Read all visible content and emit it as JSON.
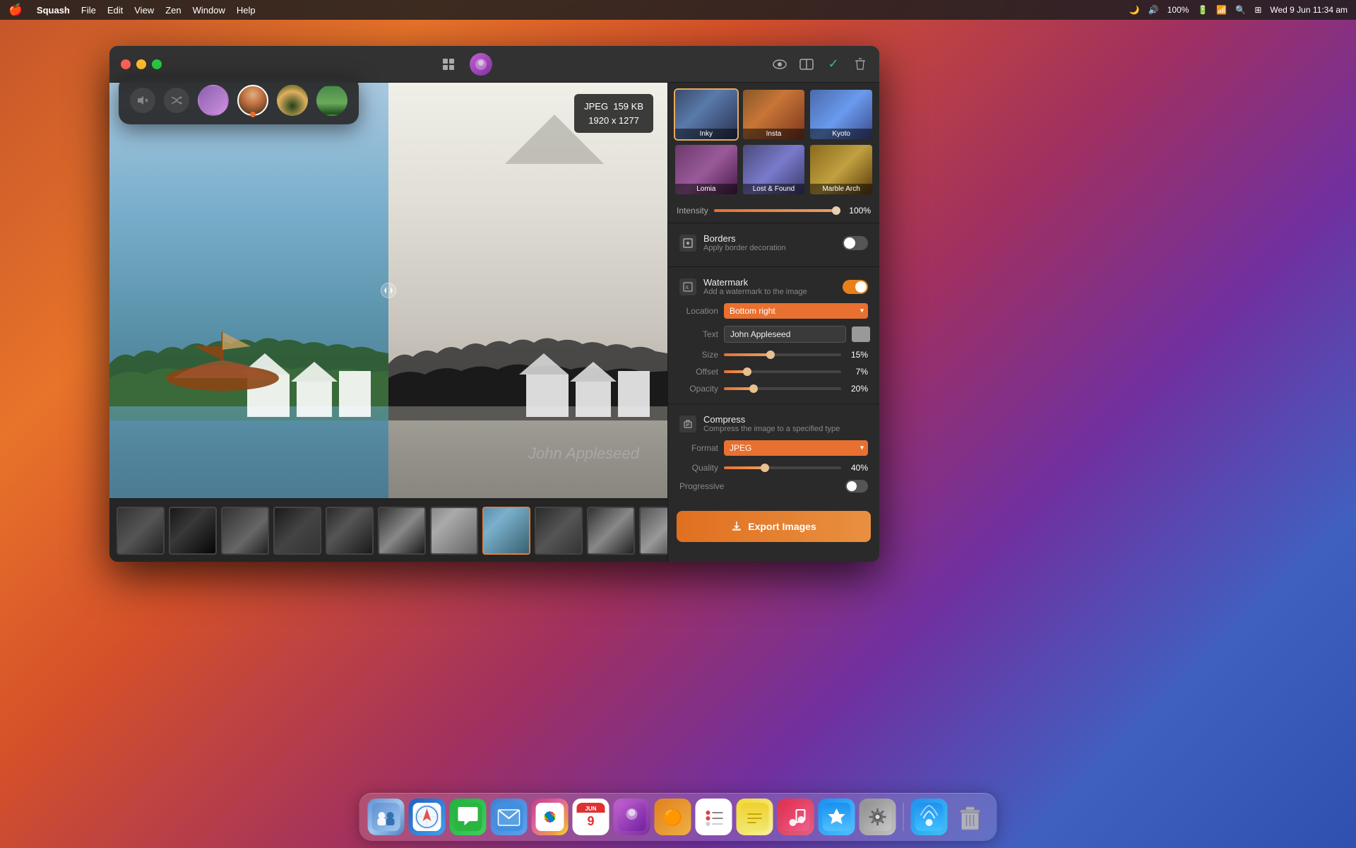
{
  "menubar": {
    "apple": "🍎",
    "app_name": "Squash",
    "menus": [
      "File",
      "Edit",
      "View",
      "Zen",
      "Window",
      "Help"
    ],
    "right_items": [
      "Wed 9 Jun  11:34 am"
    ],
    "battery": "100%"
  },
  "titlebar": {
    "preview_label": "👁",
    "split_label": "⊟",
    "done_label": "✓",
    "delete_label": "🗑"
  },
  "image_info": {
    "format": "JPEG",
    "size": "159 KB",
    "dimensions": "1920 x 1277"
  },
  "watermark_text": "John Appleseed",
  "filters": {
    "items": [
      {
        "id": "inky",
        "label": "Inky",
        "active": true
      },
      {
        "id": "insta",
        "label": "Insta",
        "active": false
      },
      {
        "id": "kyoto",
        "label": "Kyoto",
        "active": false
      },
      {
        "id": "lomia",
        "label": "Lomia",
        "active": false
      },
      {
        "id": "lostandfound",
        "label": "Lost & Found",
        "active": false
      },
      {
        "id": "marble",
        "label": "Marble Arch",
        "active": false
      }
    ],
    "intensity_label": "Intensity",
    "intensity_value": "100%",
    "intensity_percent": 100
  },
  "borders_section": {
    "title": "Borders",
    "subtitle": "Apply border decoration",
    "enabled": false
  },
  "watermark_section": {
    "title": "Watermark",
    "subtitle": "Add a watermark to the image",
    "enabled": true,
    "location_label": "Location",
    "location_value": "Bottom right",
    "text_label": "Text",
    "text_value": "John Appleseed",
    "size_label": "Size",
    "size_value": "15%",
    "size_percent": 40,
    "offset_label": "Offset",
    "offset_value": "7%",
    "offset_percent": 20,
    "opacity_label": "Opacity",
    "opacity_value": "20%",
    "opacity_percent": 25
  },
  "compress_section": {
    "title": "Compress",
    "subtitle": "Compress the image to a specified type",
    "format_label": "Format",
    "format_value": "JPEG",
    "quality_label": "Quality",
    "quality_value": "40%",
    "quality_percent": 35,
    "progressive_label": "Progressive",
    "progressive_enabled": false
  },
  "export": {
    "button_label": "Export Images"
  },
  "float_toolbar": {
    "mute_icon": "🔇",
    "shuffle_icon": "⇄",
    "filters": [
      {
        "id": "fc1",
        "active": false
      },
      {
        "id": "fc2",
        "active": true
      },
      {
        "id": "fc3",
        "active": false
      },
      {
        "id": "fc4",
        "active": false
      }
    ]
  },
  "thumbnails": {
    "add_label": "+",
    "items": [
      {
        "id": 1,
        "active": false
      },
      {
        "id": 2,
        "active": false
      },
      {
        "id": 3,
        "active": false
      },
      {
        "id": 4,
        "active": false
      },
      {
        "id": 5,
        "active": false
      },
      {
        "id": 6,
        "active": false
      },
      {
        "id": 7,
        "active": false
      },
      {
        "id": 8,
        "active": true
      },
      {
        "id": 9,
        "active": false
      },
      {
        "id": 10,
        "active": false
      },
      {
        "id": 11,
        "active": false
      }
    ]
  },
  "dock": {
    "items": [
      {
        "id": "finder",
        "emoji": "🙂",
        "class": "di-finder"
      },
      {
        "id": "safari",
        "emoji": "🧭",
        "class": "di-safari"
      },
      {
        "id": "messages",
        "emoji": "💬",
        "class": "di-messages"
      },
      {
        "id": "mail",
        "emoji": "✉️",
        "class": "di-mail"
      },
      {
        "id": "photos",
        "emoji": "🌅",
        "class": "di-photos"
      },
      {
        "id": "cal",
        "emoji": "📅",
        "class": "di-cal"
      },
      {
        "id": "squash",
        "emoji": "🟣",
        "class": "di-squash"
      },
      {
        "id": "sugar",
        "emoji": "🟠",
        "class": "di-sugar"
      },
      {
        "id": "reminders",
        "emoji": "☑️",
        "class": "di-reminders"
      },
      {
        "id": "notes",
        "emoji": "📝",
        "class": "di-notes"
      },
      {
        "id": "music",
        "emoji": "🎵",
        "class": "di-music"
      },
      {
        "id": "appstore",
        "emoji": "🅰️",
        "class": "di-appstore"
      },
      {
        "id": "syspref",
        "emoji": "⚙️",
        "class": "di-syspref"
      },
      {
        "id": "airdrop",
        "emoji": "📤",
        "class": "di-airdrop"
      },
      {
        "id": "trash",
        "emoji": "🗑️",
        "class": "di-trash"
      }
    ]
  }
}
